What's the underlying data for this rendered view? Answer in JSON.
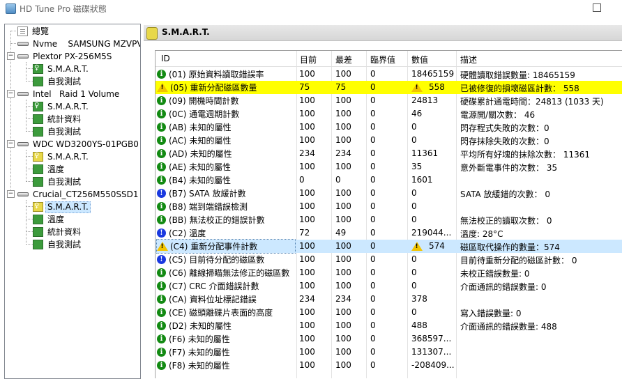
{
  "window": {
    "title": "HD Tune Pro 磁碟狀態"
  },
  "tree": [
    {
      "label": "總覽",
      "icon": "overview-doc-icon"
    },
    {
      "label": "Nvme    SAMSUNG MZVPV",
      "icon": "drive-icon"
    },
    {
      "label": "Plextor PX-256M5S",
      "icon": "drive-icon"
    },
    {
      "label": "S.M.A.R.T.",
      "icon": "smart-bulb-icon"
    },
    {
      "label": "自我測試",
      "icon": "selftest-icon"
    },
    {
      "label": "Intel   Raid 1 Volume",
      "icon": "drive-icon"
    },
    {
      "label": "S.M.A.R.T.",
      "icon": "smart-bulb-icon"
    },
    {
      "label": "統計資料",
      "icon": "statistics-icon"
    },
    {
      "label": "自我測試",
      "icon": "selftest-icon"
    },
    {
      "label": "WDC WD3200YS-01PGB0",
      "icon": "drive-icon"
    },
    {
      "label": "S.M.A.R.T.",
      "icon": "smart-bulb-icon"
    },
    {
      "label": "溫度",
      "icon": "thermometer-icon"
    },
    {
      "label": "自我測試",
      "icon": "selftest-icon"
    },
    {
      "label": "Crucial_CT256M550SSD1",
      "icon": "drive-icon"
    },
    {
      "label": "S.M.A.R.T.",
      "icon": "smart-bulb-icon"
    },
    {
      "label": "溫度",
      "icon": "thermometer-icon"
    },
    {
      "label": "統計資料",
      "icon": "statistics-icon"
    },
    {
      "label": "自我測試",
      "icon": "selftest-icon"
    }
  ],
  "panel": {
    "title": "S.M.A.R.T."
  },
  "table": {
    "headers": {
      "id": "ID",
      "current": "目前",
      "worst": "最差",
      "threshold": "臨界值",
      "value": "數值",
      "desc": "描述"
    },
    "rows": [
      {
        "status": "ok",
        "id": "(01) 原始資料讀取錯誤率",
        "cur": "100",
        "wor": "100",
        "thr": "0",
        "val": "18465159",
        "desc": "硬體讀取錯誤數量: 18465159"
      },
      {
        "status": "warn",
        "id": "(05) 重新分配磁區數量",
        "cur": "75",
        "wor": "75",
        "thr": "0",
        "val": "558",
        "desc": "已被修復的損壞磁區計數： 558"
      },
      {
        "status": "ok",
        "id": "(09) 開機時間計數",
        "cur": "100",
        "wor": "100",
        "thr": "0",
        "val": "24813",
        "desc": "硬碟累計通電時間：24813 (1033 天)"
      },
      {
        "status": "ok",
        "id": "(0C) 通電週期計數",
        "cur": "100",
        "wor": "100",
        "thr": "0",
        "val": "46",
        "desc": "電源開/關次數： 46"
      },
      {
        "status": "ok",
        "id": "(AB) 未知的屬性",
        "cur": "100",
        "wor": "100",
        "thr": "0",
        "val": "0",
        "desc": "閃存程式失敗的次數：0"
      },
      {
        "status": "ok",
        "id": "(AC) 未知的屬性",
        "cur": "100",
        "wor": "100",
        "thr": "0",
        "val": "0",
        "desc": "閃存抹除失敗的次數：0"
      },
      {
        "status": "ok",
        "id": "(AD) 未知的屬性",
        "cur": "234",
        "wor": "234",
        "thr": "0",
        "val": "11361",
        "desc": "平均所有好塊的抹除次數： 11361"
      },
      {
        "status": "ok",
        "id": "(AE) 未知的屬性",
        "cur": "100",
        "wor": "100",
        "thr": "0",
        "val": "35",
        "desc": "意外斷電事件的次數： 35"
      },
      {
        "status": "ok",
        "id": "(B4) 未知的屬性",
        "cur": "0",
        "wor": "0",
        "thr": "0",
        "val": "1601",
        "desc": ""
      },
      {
        "status": "info",
        "id": "(B7) SATA 放緩計數",
        "cur": "100",
        "wor": "100",
        "thr": "0",
        "val": "0",
        "desc": "SATA 放緩錯的次數： 0"
      },
      {
        "status": "ok",
        "id": "(B8) 端到端錯誤檢測",
        "cur": "100",
        "wor": "100",
        "thr": "0",
        "val": "0",
        "desc": ""
      },
      {
        "status": "ok",
        "id": "(BB) 無法校正的錯誤計數",
        "cur": "100",
        "wor": "100",
        "thr": "0",
        "val": "0",
        "desc": "無法校正的讀取次數： 0"
      },
      {
        "status": "info",
        "id": "(C2) 溫度",
        "cur": "72",
        "wor": "49",
        "thr": "0",
        "val": "219044...",
        "desc": "溫度: 28°C"
      },
      {
        "status": "warn-sel",
        "id": "(C4) 重新分配事件計數",
        "cur": "100",
        "wor": "100",
        "thr": "0",
        "val": "574",
        "desc": "磁區取代操作的數量：574"
      },
      {
        "status": "info",
        "id": "(C5) 目前待分配的磁區數",
        "cur": "100",
        "wor": "100",
        "thr": "0",
        "val": "0",
        "desc": "目前待重新分配的磁區計數： 0"
      },
      {
        "status": "ok",
        "id": "(C6) 離線掃瞄無法修正的磁區數",
        "cur": "100",
        "wor": "100",
        "thr": "0",
        "val": "0",
        "desc": "未校正錯誤數量: 0"
      },
      {
        "status": "ok",
        "id": "(C7) CRC 介面錯誤計數",
        "cur": "100",
        "wor": "100",
        "thr": "0",
        "val": "0",
        "desc": "介面通訊的錯誤數量: 0"
      },
      {
        "status": "ok",
        "id": "(CA) 資料位址標記錯誤",
        "cur": "234",
        "wor": "234",
        "thr": "0",
        "val": "378",
        "desc": ""
      },
      {
        "status": "ok",
        "id": "(CE) 磁頭離碟片表面的高度",
        "cur": "100",
        "wor": "100",
        "thr": "0",
        "val": "0",
        "desc": "寫入錯誤數量: 0"
      },
      {
        "status": "ok",
        "id": "(D2) 未知的屬性",
        "cur": "100",
        "wor": "100",
        "thr": "0",
        "val": "488",
        "desc": "介面通訊的錯誤數量: 488"
      },
      {
        "status": "ok",
        "id": "(F6) 未知的屬性",
        "cur": "100",
        "wor": "100",
        "thr": "0",
        "val": "368597...",
        "desc": ""
      },
      {
        "status": "ok",
        "id": "(F7) 未知的屬性",
        "cur": "100",
        "wor": "100",
        "thr": "0",
        "val": "131307...",
        "desc": ""
      },
      {
        "status": "ok",
        "id": "(F8) 未知的屬性",
        "cur": "100",
        "wor": "100",
        "thr": "0",
        "val": "-208409...",
        "desc": ""
      }
    ]
  },
  "colors": {
    "warn_row": "#ffff00",
    "selected_row": "#cce8ff",
    "ok_icon": "#128a12",
    "info_icon": "#1a39e0"
  }
}
